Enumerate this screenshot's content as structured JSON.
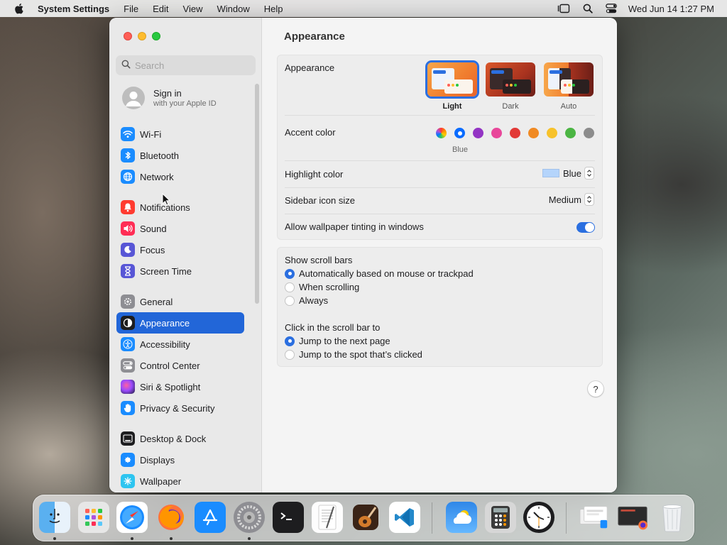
{
  "menubar": {
    "app_name": "System Settings",
    "menus": [
      "File",
      "Edit",
      "View",
      "Window",
      "Help"
    ],
    "clock": "Wed Jun 14  1:27 PM"
  },
  "sidebar": {
    "search_placeholder": "Search",
    "signin": {
      "title": "Sign in",
      "subtitle": "with your Apple ID"
    },
    "items": [
      {
        "label": "Wi-Fi",
        "icon": "wifi-icon",
        "color": "#1a8cff"
      },
      {
        "label": "Bluetooth",
        "icon": "bluetooth-icon",
        "color": "#1a8cff"
      },
      {
        "label": "Network",
        "icon": "globe-icon",
        "color": "#1a8cff"
      },
      {
        "label": "Notifications",
        "icon": "bell-icon",
        "color": "#ff3b30"
      },
      {
        "label": "Sound",
        "icon": "speaker-icon",
        "color": "#ff2d55"
      },
      {
        "label": "Focus",
        "icon": "moon-icon",
        "color": "#5856d6"
      },
      {
        "label": "Screen Time",
        "icon": "hourglass-icon",
        "color": "#5856d6"
      },
      {
        "label": "General",
        "icon": "gear-icon",
        "color": "#8e8e93"
      },
      {
        "label": "Appearance",
        "icon": "appearance-icon",
        "color": "#1d1d1f"
      },
      {
        "label": "Accessibility",
        "icon": "accessibility-icon",
        "color": "#1a8cff"
      },
      {
        "label": "Control Center",
        "icon": "control-center-icon",
        "color": "#8e8e93"
      },
      {
        "label": "Siri & Spotlight",
        "icon": "siri-icon",
        "color": "#b83bdc"
      },
      {
        "label": "Privacy & Security",
        "icon": "hand-icon",
        "color": "#1a8cff"
      },
      {
        "label": "Desktop & Dock",
        "icon": "dock-icon",
        "color": "#1d1d1f"
      },
      {
        "label": "Displays",
        "icon": "display-icon",
        "color": "#1a8cff"
      },
      {
        "label": "Wallpaper",
        "icon": "wallpaper-icon",
        "color": "#2ec5f0"
      }
    ],
    "selected": "Appearance"
  },
  "main": {
    "title": "Appearance",
    "appearance_label": "Appearance",
    "themes": [
      "Light",
      "Dark",
      "Auto"
    ],
    "selected_theme": "Light",
    "accent_label": "Accent color",
    "accent_colors": [
      "multicolor",
      "#0a6cff",
      "#9334c4",
      "#e8479a",
      "#e23a37",
      "#f08a24",
      "#f7c22b",
      "#4bb543",
      "#8c8c8c"
    ],
    "accent_selected_name": "Blue",
    "highlight_label": "Highlight color",
    "highlight_value": "Blue",
    "highlight_swatch": "#b4d4fb",
    "sidebar_icon_label": "Sidebar icon size",
    "sidebar_icon_value": "Medium",
    "tinting_label": "Allow wallpaper tinting in windows",
    "tinting_on": true,
    "scroll_bars_label": "Show scroll bars",
    "scroll_bars_options": [
      "Automatically based on mouse or trackpad",
      "When scrolling",
      "Always"
    ],
    "scroll_bars_selected": 0,
    "click_label": "Click in the scroll bar to",
    "click_options": [
      "Jump to the next page",
      "Jump to the spot that’s clicked"
    ],
    "click_selected": 0,
    "help": "?"
  },
  "dock": {
    "apps": [
      "finder-icon",
      "launchpad-icon",
      "safari-icon",
      "firefox-icon",
      "app-store-icon",
      "system-settings-icon",
      "terminal-icon",
      "textedit-icon",
      "garageband-icon",
      "vscode-icon",
      "weather-icon",
      "calculator-icon",
      "clock-icon",
      "downloads-stack-icon",
      "recent-window-icon",
      "trash-icon"
    ]
  }
}
